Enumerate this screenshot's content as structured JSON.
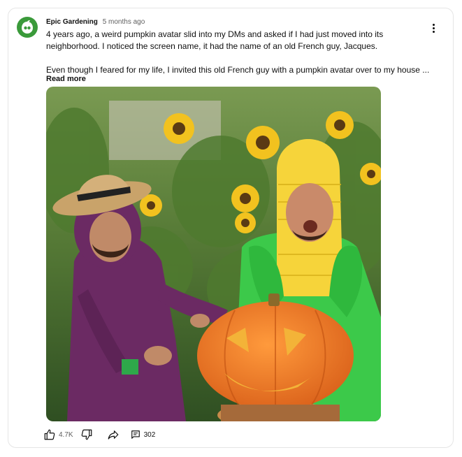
{
  "post": {
    "author": "Epic Gardening",
    "time": "5 months ago",
    "paragraph1": "4 years ago, a weird pumpkin avatar slid into my DMs and asked if I had just moved into its neighborhood. I noticed the screen name, it had the name of an old French guy, Jacques.",
    "paragraph2": "Even though I feared for my life, I invited this old French guy with a pumpkin avatar over to my house ...",
    "read_more": "Read more"
  },
  "actions": {
    "like_count": "4.7K",
    "comment_count": "302"
  },
  "icons": {
    "avatar": "epic-gardening-logo-icon",
    "menu": "more-vert-icon",
    "like": "thumbs-up-icon",
    "dislike": "thumbs-down-icon",
    "share": "share-arrow-icon",
    "comment": "comment-icon"
  },
  "colors": {
    "brand_green": "#3a9a3a",
    "text_primary": "#0f0f0f",
    "text_secondary": "#606060",
    "border": "#e5e5e5"
  }
}
